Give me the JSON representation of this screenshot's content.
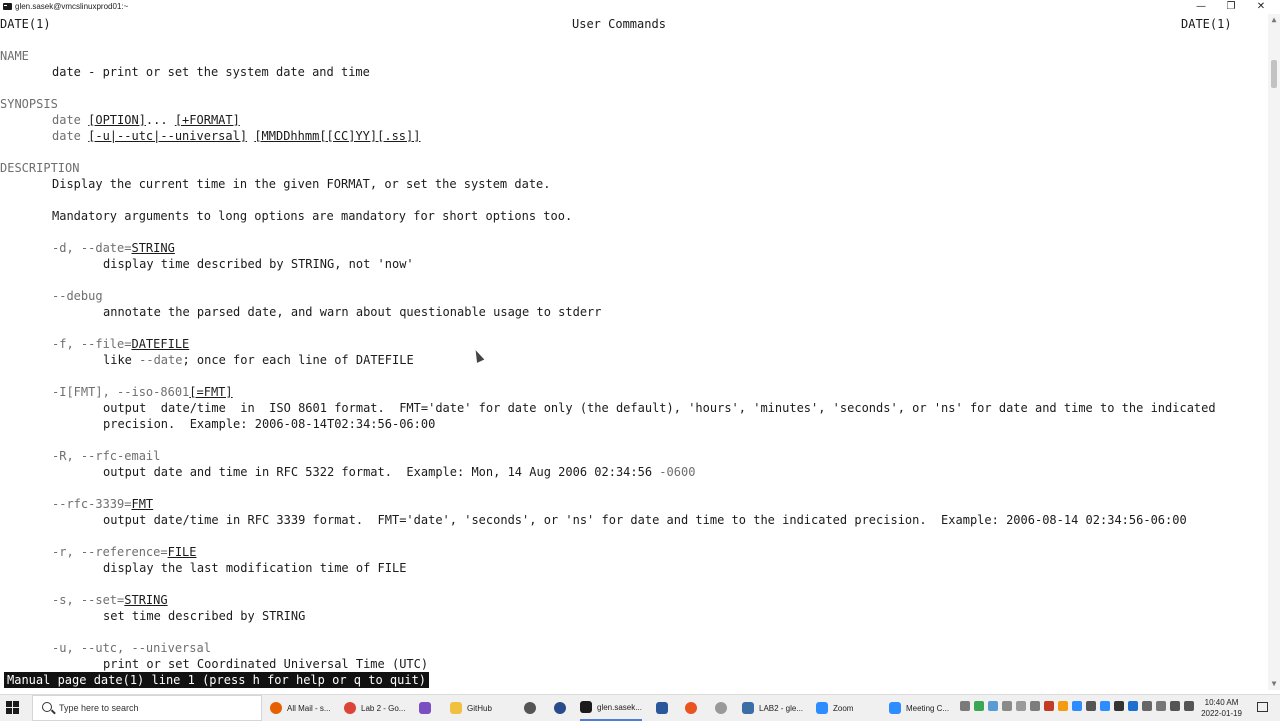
{
  "window": {
    "title": "glen.sasek@vmcslinuxprod01:~",
    "minimize": "—",
    "maximize": "❐",
    "close": "✕"
  },
  "man": {
    "header_left": "DATE(1)",
    "header_center": "User Commands",
    "header_right": "DATE(1)",
    "name_heading": "NAME",
    "name_text": "date - print or set the system date and time",
    "synopsis_heading": "SYNOPSIS",
    "syn1_cmd": "date ",
    "syn1_opt": "[OPTION]",
    "syn1_mid": "... ",
    "syn1_fmt": "[+FORMAT]",
    "syn2_cmd": "date ",
    "syn2_opt": "[-u|--utc|--universal]",
    "syn2_sp": " ",
    "syn2_arg": "[MMDDhhmm[[CC]YY][.ss]]",
    "description_heading": "DESCRIPTION",
    "desc1": "Display the current time in the given FORMAT, or set the system date.",
    "desc2": "Mandatory arguments to long options are mandatory for short options too.",
    "opt_d_flag": "-d, --date=",
    "opt_d_arg": "STRING",
    "opt_d_desc": "display time described by STRING, not 'now'",
    "opt_debug_flag": "--debug",
    "opt_debug_desc": "annotate the parsed date, and warn about questionable usage to stderr",
    "opt_f_flag": "-f, --file=",
    "opt_f_arg": "DATEFILE",
    "opt_f_desc_a": "like ",
    "opt_f_desc_b": "--date",
    "opt_f_desc_c": "; once for each line of DATEFILE",
    "opt_I_flag": "-I[FMT], --iso-8601",
    "opt_I_arg": "[=FMT]",
    "opt_I_desc1": "output  date/time  in  ISO 8601 format.  FMT='date' for date only (the default), 'hours', 'minutes', 'seconds', or 'ns' for date and time to the indicated",
    "opt_I_desc2": "precision.  Example: 2006-08-14T02:34:56-06:00",
    "opt_R_flag": "-R, --rfc-email",
    "opt_R_desc_a": "output date and time in RFC 5322 format.  Example: Mon, 14 Aug 2006 02:34:56 ",
    "opt_R_desc_b": "-0600",
    "opt_rfc_flag": "--rfc-3339=",
    "opt_rfc_arg": "FMT",
    "opt_rfc_desc": "output date/time in RFC 3339 format.  FMT='date', 'seconds', or 'ns' for date and time to the indicated precision.  Example: 2006-08-14 02:34:56-06:00",
    "opt_r_flag": "-r, --reference=",
    "opt_r_arg": "FILE",
    "opt_r_desc": "display the last modification time of FILE",
    "opt_s_flag": "-s, --set=",
    "opt_s_arg": "STRING",
    "opt_s_desc": "set time described by STRING",
    "opt_u_flag": "-u, --utc, --universal",
    "opt_u_desc": "print or set Coordinated Universal Time (UTC)",
    "status": "Manual page date(1) line 1 (press h for help or q to quit)"
  },
  "scrollbar": {
    "up": "▲",
    "down": "▼"
  },
  "taskbar": {
    "search_placeholder": "Type here to search",
    "apps": [
      {
        "label": "All Mail - s...",
        "icon": "firefox-icon",
        "color": "#e66000"
      },
      {
        "label": "Lab 2 - Go...",
        "icon": "chrome-icon",
        "color": "#db4437"
      },
      {
        "label": "",
        "icon": "visual-studio-icon",
        "color": "#7b4fc1"
      },
      {
        "label": "GitHub",
        "icon": "folder-icon",
        "color": "#f0c040"
      },
      {
        "label": "",
        "icon": "settings-gear-icon",
        "color": "#555555"
      },
      {
        "label": "",
        "icon": "vpn-lock-icon",
        "color": "#2a4a8a"
      },
      {
        "label": "glen.sasek...",
        "icon": "terminal-icon",
        "color": "#1b1b1b"
      },
      {
        "label": "",
        "icon": "word-icon",
        "color": "#2b579a"
      },
      {
        "label": "",
        "icon": "ubuntu-icon",
        "color": "#e95420"
      },
      {
        "label": "",
        "icon": "network-tool-icon",
        "color": "#999999"
      },
      {
        "label": "LAB2 - gle...",
        "icon": "remote-desktop-icon",
        "color": "#3a6ea5"
      },
      {
        "label": "Zoom",
        "icon": "zoom-icon",
        "color": "#2d8cff"
      },
      {
        "label": "Meeting C...",
        "icon": "zoom-meeting-icon",
        "color": "#2d8cff"
      }
    ],
    "time": "10:40 AM",
    "date": "2022-01-19"
  }
}
